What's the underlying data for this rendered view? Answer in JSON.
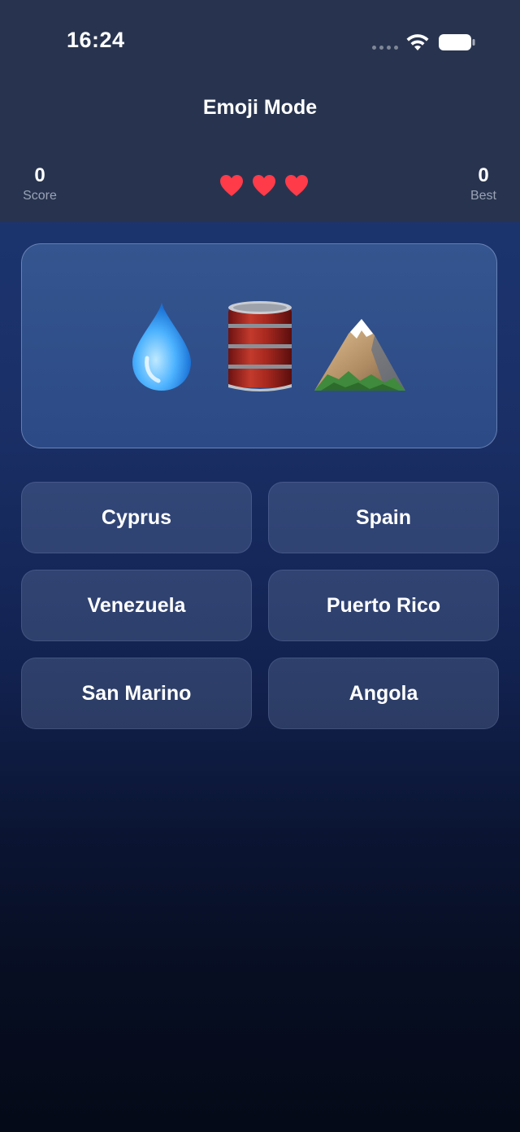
{
  "status_bar": {
    "time": "16:24",
    "icons": [
      "signal-dots-icon",
      "wifi-icon",
      "battery-icon"
    ]
  },
  "header": {
    "title": "Emoji Mode"
  },
  "stats": {
    "score_value": "0",
    "score_label": "Score",
    "best_value": "0",
    "best_label": "Best",
    "lives": 3,
    "life_icon": "heart-icon",
    "life_color": "#ff3b4a"
  },
  "puzzle": {
    "emojis": [
      "droplet",
      "oil-drum",
      "snow-capped-mountain"
    ]
  },
  "answers": [
    {
      "label": "Cyprus"
    },
    {
      "label": "Spain"
    },
    {
      "label": "Venezuela"
    },
    {
      "label": "Puerto Rico"
    },
    {
      "label": "San Marino"
    },
    {
      "label": "Angola"
    }
  ],
  "colors": {
    "header_bg": "#28344f",
    "card_bg": "#34558f",
    "background_top": "#1d3a78",
    "background_bottom": "#050a18"
  }
}
